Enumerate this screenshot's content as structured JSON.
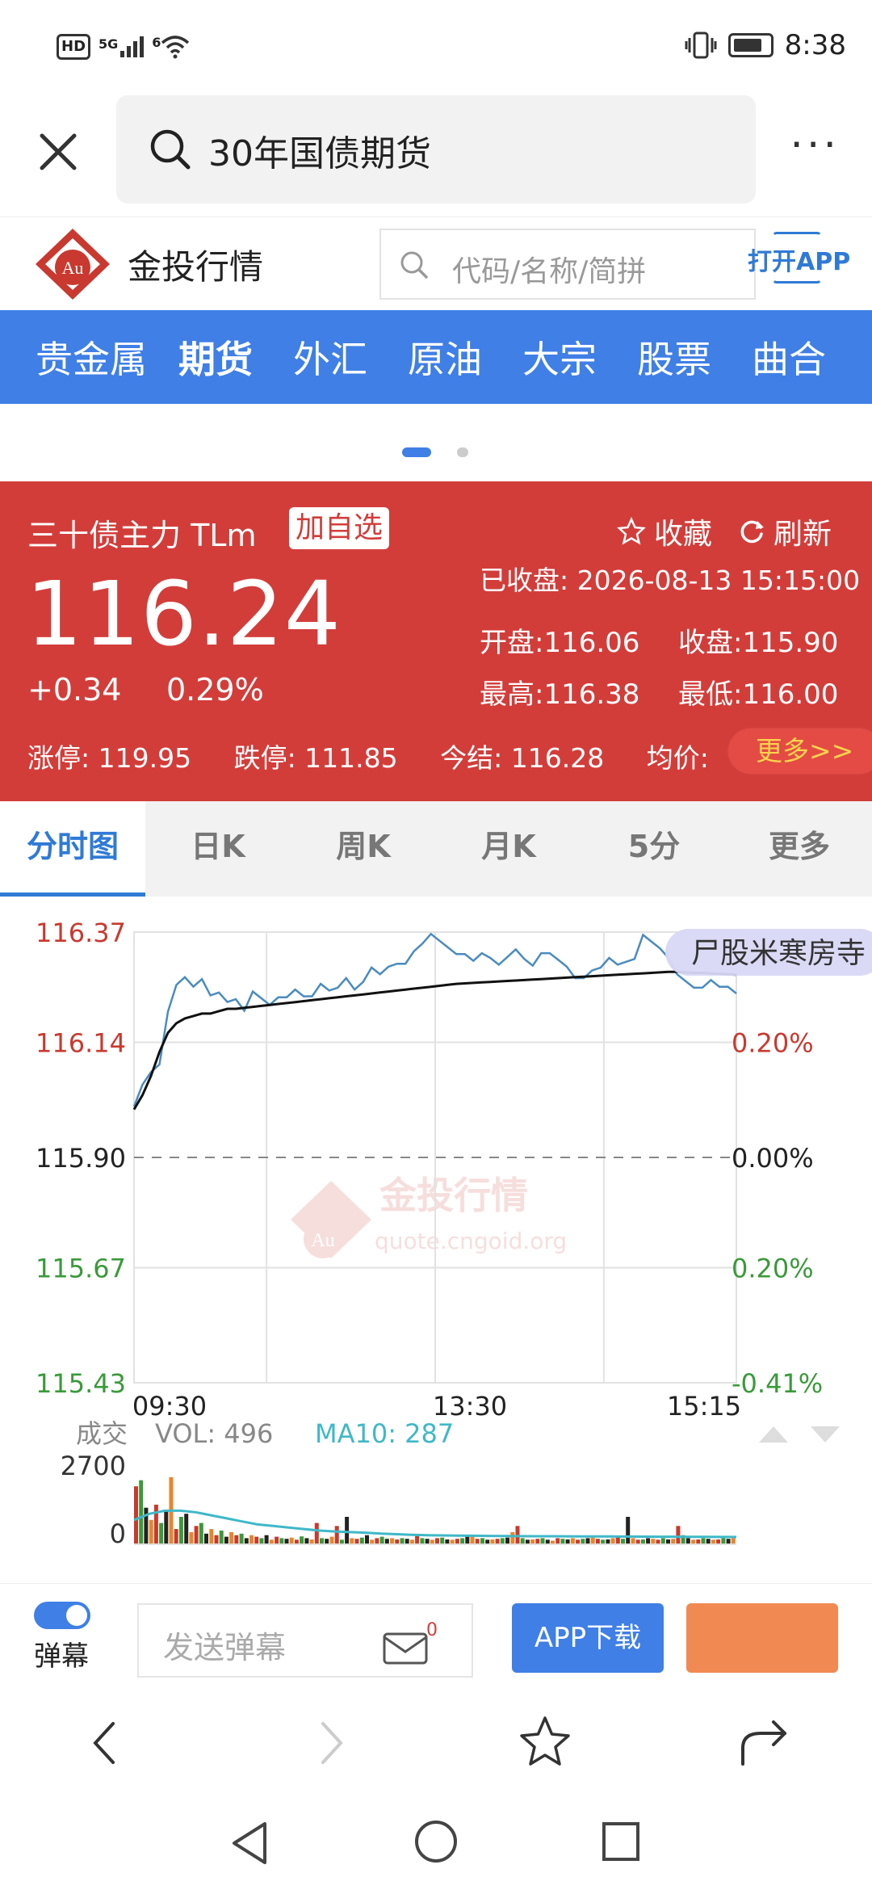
{
  "status_bar": {
    "hd": "HD",
    "signal": "5G",
    "wifi": "6",
    "time": "8:38"
  },
  "browser": {
    "search_text": "30年国债期货"
  },
  "site": {
    "name": "金投行情",
    "logo_text": "Au",
    "search_placeholder": "代码/名称/简拼",
    "open_app": "打开APP"
  },
  "nav": {
    "items": [
      "贵金属",
      "期货",
      "外汇",
      "原油",
      "大宗",
      "股票",
      "曲合"
    ],
    "active_index": 1
  },
  "quote": {
    "title": "三十债主力 TLm",
    "add_watch": "加自选",
    "favorite": "收藏",
    "refresh": "刷新",
    "price": "116.24",
    "change": "+0.34",
    "change_pct": "0.29%",
    "closed_at": "已收盘: 2026-08-13 15:15:00",
    "open": "开盘:116.06",
    "close": "收盘:115.90",
    "high": "最高:116.38",
    "low": "最低:116.00",
    "limit_up": "涨停: 119.95",
    "limit_down": "跌停: 111.85",
    "settle": "今结: 116.28",
    "avg": "均价:",
    "more": "更多>>"
  },
  "tabs": [
    "分时图",
    "日K",
    "周K",
    "月K",
    "5分",
    "更多"
  ],
  "chart_data": {
    "type": "line",
    "y_ticks_left": [
      "116.37",
      "116.14",
      "115.90",
      "115.67",
      "115.43"
    ],
    "y_ticks_right": [
      "",
      "0.20%",
      "0.00%",
      "0.20%",
      "-0.41%"
    ],
    "x_ticks": [
      "09:30",
      "13:30",
      "15:15"
    ],
    "ylim": [
      115.43,
      116.37
    ],
    "prev_close": 115.9,
    "series": [
      {
        "color": "#4a8bbf",
        "values": [
          116.0,
          116.05,
          116.08,
          116.1,
          116.2,
          116.26,
          116.28,
          116.25,
          116.27,
          116.24,
          116.25,
          116.22,
          116.23,
          116.21,
          116.24,
          116.23,
          116.22,
          116.24,
          116.23,
          116.25,
          116.24,
          116.23,
          116.26,
          116.25,
          116.26,
          116.27,
          116.25,
          116.27,
          116.29,
          116.28,
          116.3,
          116.31,
          116.3,
          116.33,
          116.35,
          116.36,
          116.35,
          116.34,
          116.33,
          116.32,
          116.31,
          116.33,
          116.31,
          116.3,
          116.32,
          116.34,
          116.31,
          116.3,
          116.33,
          116.32,
          116.31,
          116.3,
          116.28,
          116.27,
          116.29,
          116.3,
          116.31,
          116.3,
          116.31,
          116.32,
          116.36,
          116.35,
          116.34,
          116.31,
          116.28,
          116.27,
          116.26,
          116.25,
          116.27,
          116.26,
          116.25,
          116.24
        ]
      },
      {
        "color": "#111111",
        "values": [
          116.0,
          116.03,
          116.07,
          116.12,
          116.16,
          116.18,
          116.19,
          116.195,
          116.2,
          116.2,
          116.205,
          116.21,
          116.21,
          116.212,
          116.214,
          116.216,
          116.218,
          116.22,
          116.222,
          116.224,
          116.226,
          116.228,
          116.23,
          116.232,
          116.234,
          116.236,
          116.238,
          116.24,
          116.242,
          116.244,
          116.246,
          116.248,
          116.25,
          116.252,
          116.254,
          116.256,
          116.258,
          116.26,
          116.262,
          116.263,
          116.264,
          116.265,
          116.266,
          116.267,
          116.268,
          116.269,
          116.27,
          116.271,
          116.272,
          116.273,
          116.274,
          116.275,
          116.276,
          116.277,
          116.278,
          116.279,
          116.28,
          116.281,
          116.282,
          116.283,
          116.284,
          116.285,
          116.286,
          116.287,
          116.287,
          116.286,
          116.285,
          116.285,
          116.284,
          116.283,
          116.282,
          116.281
        ]
      }
    ],
    "watermark": {
      "name": "金投行情",
      "url": "quote.cngoid.org",
      "logo": "Au"
    },
    "danmaku_text": "尸股米寒房寺",
    "volume": {
      "label": "成交",
      "vol": "VOL: 496",
      "ma10": "MA10: 287",
      "y_ticks": [
        "2700",
        "0"
      ],
      "ylim": [
        0,
        2700
      ],
      "bars": [
        1900,
        2100,
        1200,
        800,
        1300,
        700,
        1100,
        2200,
        500,
        900,
        1000,
        400,
        600,
        700,
        350,
        500,
        300,
        450,
        250,
        400,
        300,
        350,
        200,
        300,
        250,
        200,
        300,
        150,
        250,
        200,
        180,
        220,
        150,
        260,
        200,
        160,
        700,
        200,
        180,
        250,
        600,
        150,
        900,
        200,
        180,
        220,
        300,
        150,
        200,
        250,
        180,
        200,
        160,
        200,
        180,
        150,
        300,
        200,
        180,
        150,
        200,
        220,
        160,
        150,
        180,
        200,
        250,
        300,
        180,
        200,
        150,
        160,
        180,
        200,
        220,
        400,
        600,
        200,
        150,
        160,
        180,
        200,
        150,
        120,
        200,
        180,
        160,
        200,
        150,
        180,
        200,
        220,
        180,
        150,
        160,
        200,
        250,
        180,
        900,
        200,
        150,
        160,
        200,
        180,
        150,
        200,
        160,
        180,
        600,
        300,
        200,
        150,
        160,
        200,
        180,
        150,
        160,
        200,
        180,
        200
      ],
      "ma_values": [
        800,
        1000,
        1100,
        1100,
        1050,
        950,
        850,
        750,
        650,
        600,
        550,
        500,
        450,
        420,
        400,
        380,
        350,
        330,
        310,
        300,
        290,
        285,
        280,
        275,
        270,
        268,
        266,
        264,
        262,
        260,
        258,
        256,
        254,
        252,
        250,
        248,
        246,
        244,
        242,
        240
      ]
    }
  },
  "bottom_bar": {
    "toggle_label": "弹幕",
    "input_placeholder": "发送弹幕",
    "message_count": "0",
    "app_download": "APP下载"
  }
}
